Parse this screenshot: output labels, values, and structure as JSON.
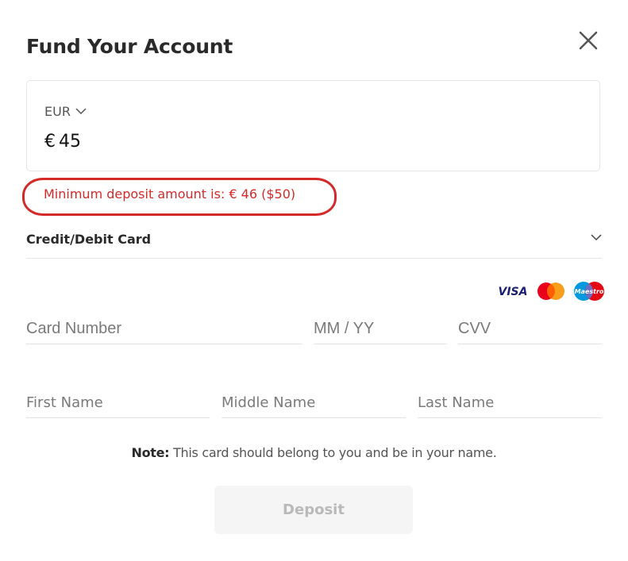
{
  "dialog": {
    "title": "Fund Your Account",
    "close_icon": "close-icon"
  },
  "amount": {
    "currency": "EUR",
    "currency_icon": "chevron-down-icon",
    "symbol": "€",
    "value": "45"
  },
  "error": {
    "message": "Minimum deposit amount is: € 46 ($50)",
    "color": "#d42a2a"
  },
  "payment_method": {
    "selected": "Credit/Debit Card",
    "icon": "chevron-down-icon"
  },
  "card_brands": {
    "visa": "VISA",
    "mastercard": "mastercard-logo",
    "maestro": "Maestro"
  },
  "card_fields": {
    "card_number_placeholder": "Card Number",
    "expiry_placeholder": "MM / YY",
    "cvv_placeholder": "CVV"
  },
  "name_fields": {
    "first_name_placeholder": "First Name",
    "middle_name_placeholder": "Middle Name",
    "last_name_placeholder": "Last Name"
  },
  "note": {
    "label": "Note:",
    "text": " This card should belong to you and be in your name."
  },
  "deposit": {
    "label": "Deposit",
    "state": "disabled"
  },
  "colors": {
    "visa_blue": "#1a1f71",
    "mastercard_red": "#eb001b",
    "mastercard_orange": "#f79e1b",
    "maestro_blue": "#0099df"
  }
}
